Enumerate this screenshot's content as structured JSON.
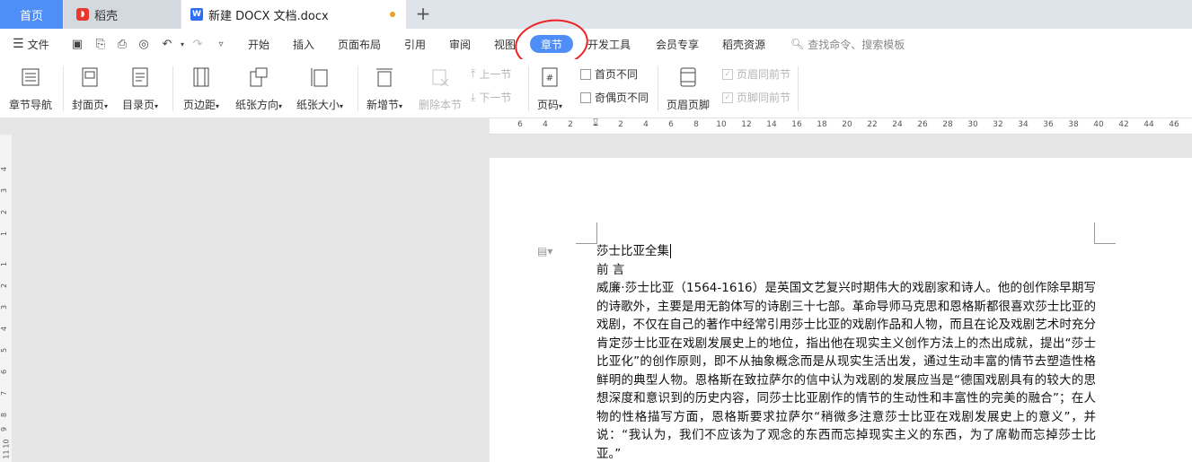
{
  "tabs": {
    "home": "首页",
    "daoke": "稻壳",
    "doc": "新建 DOCX 文档.docx"
  },
  "menu": {
    "file": "文件",
    "items": [
      "开始",
      "插入",
      "页面布局",
      "引用",
      "审阅",
      "视图",
      "章节",
      "开发工具",
      "会员专享",
      "稻壳资源"
    ],
    "search": "查找命令、搜索模板"
  },
  "ribbon": {
    "nav": "章节导航",
    "cover": "封面页",
    "toc": "目录页",
    "margin": "页边距",
    "orientation": "纸张方向",
    "size": "纸张大小",
    "new_section": "新增节",
    "delete_section": "删除本节",
    "prev_section": "上一节",
    "next_section": "下一节",
    "page_number": "页码",
    "first_page_diff": "首页不同",
    "odd_even_diff": "奇偶页不同",
    "header_footer": "页眉页脚",
    "header_same": "页眉同前节",
    "footer_same": "页脚同前节"
  },
  "ruler": {
    "h": [
      "6",
      "4",
      "2",
      "2",
      "4",
      "6",
      "8",
      "10",
      "12",
      "14",
      "16",
      "18",
      "20",
      "22",
      "24",
      "26",
      "28",
      "30",
      "32",
      "34",
      "36",
      "38",
      "40",
      "42",
      "44",
      "46"
    ],
    "v": [
      "4",
      "3",
      "2",
      "1",
      "1",
      "2",
      "3",
      "4",
      "5",
      "6",
      "7",
      "8",
      "9",
      "10",
      "11"
    ]
  },
  "document": {
    "title": "莎士比亚全集",
    "heading": "前 言",
    "body": "威廉·莎士比亚（1564-1616）是英国文艺复兴时期伟大的戏剧家和诗人。他的创作除早期写的诗歌外，主要是用无韵体写的诗剧三十七部。革命导师马克思和恩格斯都很喜欢莎士比亚的戏剧，不仅在自己的著作中经常引用莎士比亚的戏剧作品和人物，而且在论及戏剧艺术时充分肯定莎士比亚在戏剧发展史上的地位，指出他在现实主义创作方法上的杰出成就，提出“莎士比亚化”的创作原则，即不从抽象概念而是从现实生活出发，通过生动丰富的情节去塑造性格鲜明的典型人物。恩格斯在致拉萨尔的信中认为戏剧的发展应当是“德国戏剧具有的较大的思想深度和意识到的历史内容，同莎士比亚剧作的情节的生动性和丰富性的完美的融合”；在人物的性格描写方面，恩格斯要求拉萨尔“稍微多注意莎士比亚在戏剧发展史上的意义”，并说：“我认为，我们不应该为了观念的东西而忘掉现实主义的东西，为了席勒而忘掉莎士比亚。”"
  }
}
